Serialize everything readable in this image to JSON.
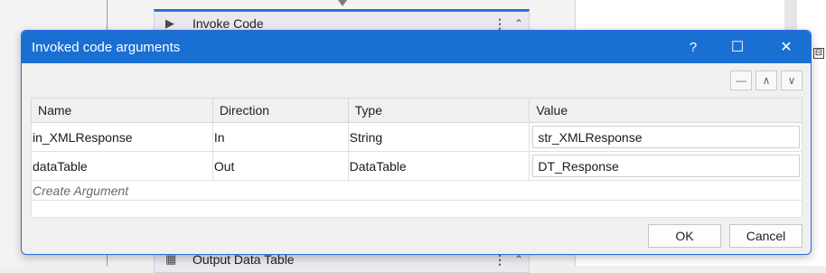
{
  "background": {
    "top_activity": {
      "title": "Invoke Code",
      "play_icon": "play-icon",
      "more_icon": "more-vertical-icon",
      "collapse_icon": "chevron-double-up-icon"
    },
    "bottom_activity": {
      "title": "Output Data Table",
      "icon": "table-icon"
    },
    "expand_marker": "⊟"
  },
  "dialog": {
    "title": "Invoked code arguments",
    "controls": {
      "help": "?",
      "maximize": "☐",
      "close": "✕"
    },
    "toolbar": {
      "remove": "—",
      "move_up": "∧",
      "move_down": "∨"
    },
    "columns": [
      "Name",
      "Direction",
      "Type",
      "Value"
    ],
    "rows": [
      {
        "name": "in_XMLResponse",
        "direction": "In",
        "type": "String",
        "value": "str_XMLResponse"
      },
      {
        "name": "dataTable",
        "direction": "Out",
        "type": "DataTable",
        "value": "DT_Response"
      }
    ],
    "create_argument": "Create Argument",
    "ok_label": "OK",
    "cancel_label": "Cancel"
  },
  "colors": {
    "accent": "#1a6fd3",
    "title_text": "#ffffff"
  }
}
